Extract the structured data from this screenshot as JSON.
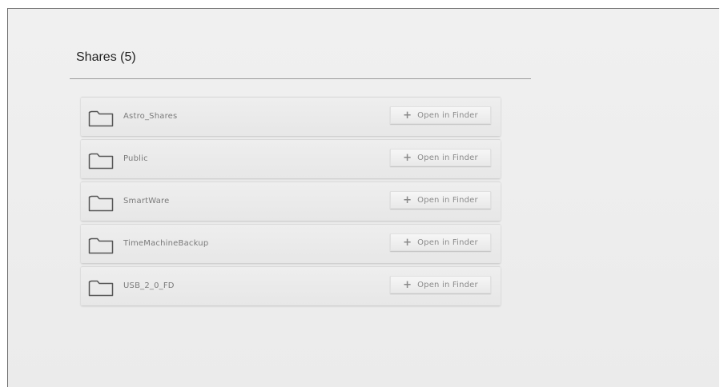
{
  "shares": {
    "title": "Shares (5)",
    "items": [
      {
        "name": "Astro_Shares",
        "action_label": "Open in Finder",
        "icon": "folder-icon"
      },
      {
        "name": "Public",
        "action_label": "Open in Finder",
        "icon": "folder-icon"
      },
      {
        "name": "SmartWare",
        "action_label": "Open in Finder",
        "icon": "folder-icon"
      },
      {
        "name": "TimeMachineBackup",
        "action_label": "Open in Finder",
        "icon": "folder-icon"
      },
      {
        "name": "USB_2_0_FD",
        "action_label": "Open in Finder",
        "icon": "folder-icon"
      }
    ]
  },
  "colors": {
    "background": "#ebebeb",
    "text": "#7a7a7a",
    "title": "#222222"
  }
}
